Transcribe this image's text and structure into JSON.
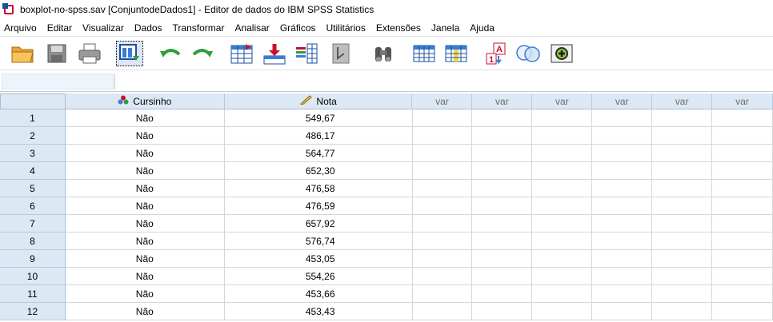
{
  "window": {
    "title": "boxplot-no-spss.sav [ConjuntodeDados1] - Editor de dados do IBM SPSS Statistics"
  },
  "menu": [
    "Arquivo",
    "Editar",
    "Visualizar",
    "Dados",
    "Transformar",
    "Analisar",
    "Gráficos",
    "Utilitários",
    "Extensões",
    "Janela",
    "Ajuda"
  ],
  "toolbar": {
    "icons": [
      "open-folder-icon",
      "save-icon",
      "print-icon",
      "recall-dialog-icon",
      "undo-icon",
      "redo-icon",
      "goto-case-icon",
      "goto-variable-icon",
      "variables-icon",
      "run-descriptives-icon",
      "find-icon",
      "insert-cases-icon",
      "insert-variable-icon",
      "value-labels-icon",
      "use-sets-icon",
      "custom-attributes-icon"
    ]
  },
  "cell_editor": {
    "reference": "",
    "value": ""
  },
  "columns": [
    {
      "label": "Cursinho",
      "icon": "nominal-variable-icon"
    },
    {
      "label": "Nota",
      "icon": "scale-variable-icon"
    },
    {
      "label": "var"
    },
    {
      "label": "var"
    },
    {
      "label": "var"
    },
    {
      "label": "var"
    },
    {
      "label": "var"
    },
    {
      "label": "var"
    }
  ],
  "rows": [
    {
      "n": "1",
      "cursinho": "Não",
      "nota": "549,67"
    },
    {
      "n": "2",
      "cursinho": "Não",
      "nota": "486,17"
    },
    {
      "n": "3",
      "cursinho": "Não",
      "nota": "564,77"
    },
    {
      "n": "4",
      "cursinho": "Não",
      "nota": "652,30"
    },
    {
      "n": "5",
      "cursinho": "Não",
      "nota": "476,58"
    },
    {
      "n": "6",
      "cursinho": "Não",
      "nota": "476,59"
    },
    {
      "n": "7",
      "cursinho": "Não",
      "nota": "657,92"
    },
    {
      "n": "8",
      "cursinho": "Não",
      "nota": "576,74"
    },
    {
      "n": "9",
      "cursinho": "Não",
      "nota": "453,05"
    },
    {
      "n": "10",
      "cursinho": "Não",
      "nota": "554,26"
    },
    {
      "n": "11",
      "cursinho": "Não",
      "nota": "453,66"
    },
    {
      "n": "12",
      "cursinho": "Não",
      "nota": "453,43"
    }
  ]
}
